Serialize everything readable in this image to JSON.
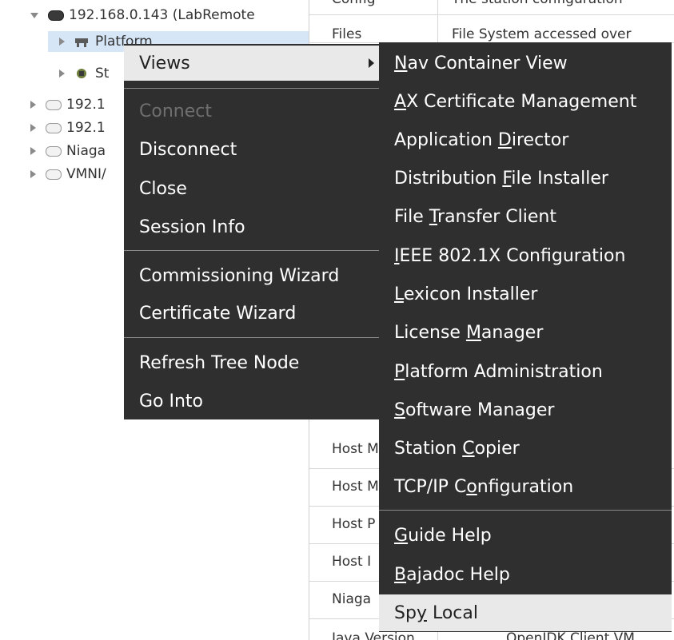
{
  "tree": {
    "station_node": "192.168.0.143 (LabRemote",
    "platform_label": "Platform",
    "station_label": "St",
    "node_3": "192.1",
    "node_4": "192.1",
    "node_5": "Niaga",
    "node_6": "VMNI/"
  },
  "table": {
    "row_config": {
      "name": "Config",
      "value": "The station configuration"
    },
    "row_files": {
      "name": "Files",
      "value": "File System accessed over"
    },
    "host_rows": [
      "Host M",
      "Host M",
      "Host P",
      "Host I",
      "Niaga"
    ],
    "bottom_row": {
      "name": "Java Version",
      "value": "OpenJDK Client VM"
    }
  },
  "context_menu": {
    "items": [
      {
        "label": "Views",
        "state": "hover"
      },
      {
        "label": "Connect",
        "state": "disabled"
      },
      {
        "label": "Disconnect",
        "state": "normal"
      },
      {
        "label": "Close",
        "state": "normal"
      },
      {
        "label": "Session Info",
        "state": "normal"
      },
      {
        "label": "Commissioning Wizard",
        "state": "normal"
      },
      {
        "label": "Certificate Wizard",
        "state": "normal"
      },
      {
        "label": "Refresh Tree Node",
        "state": "normal"
      },
      {
        "label": "Go Into",
        "state": "normal"
      }
    ]
  },
  "submenu": {
    "items": [
      {
        "label": "Nav Container View",
        "mnemonic": "N"
      },
      {
        "label": "AX Certificate Management",
        "mnemonic": "A"
      },
      {
        "label": "Application Director",
        "mnemonic": "D"
      },
      {
        "label": "Distribution File Installer",
        "mnemonic": "F"
      },
      {
        "label": "File Transfer Client",
        "mnemonic": "T"
      },
      {
        "label": "IEEE 802.1X Configuration",
        "mnemonic": "I"
      },
      {
        "label": "Lexicon Installer",
        "mnemonic": "L"
      },
      {
        "label": "License Manager",
        "mnemonic": "M"
      },
      {
        "label": "Platform Administration",
        "mnemonic": "P"
      },
      {
        "label": "Software Manager",
        "mnemonic": "S"
      },
      {
        "label": "Station Copier",
        "mnemonic": "C"
      },
      {
        "label": "TCP/IP Configuration",
        "mnemonic": "o"
      },
      {
        "label": "Guide Help",
        "mnemonic": "G"
      },
      {
        "label": "Bajadoc Help",
        "mnemonic": "B"
      },
      {
        "label": "Spy Local",
        "mnemonic": "y"
      }
    ]
  },
  "colors": {
    "menu_bg": "#2f2f2f",
    "menu_text": "#ffffff",
    "hover_bg": "#e9e9e9",
    "disabled_text": "#6f6f6f",
    "tree_selection": "#d6e6f7"
  }
}
